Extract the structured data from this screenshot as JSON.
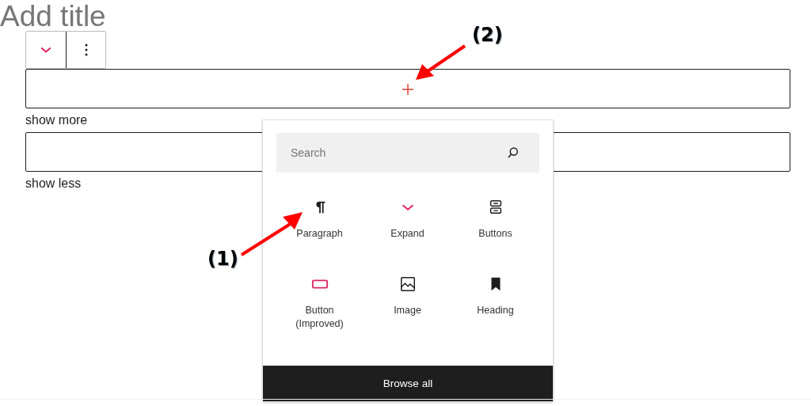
{
  "title_placeholder": "Add title",
  "block_toolbar": {
    "buttons": [
      {
        "kind": "chevron"
      },
      {
        "kind": "more"
      }
    ]
  },
  "blocks": [
    {
      "caption": "show more",
      "has_inserter": true
    },
    {
      "caption": "show less"
    }
  ],
  "inserter": {
    "search": {
      "placeholder": "Search"
    },
    "items": [
      {
        "label": "Paragraph",
        "kind": "paragraph"
      },
      {
        "label": "Expand",
        "kind": "chevron"
      },
      {
        "label": "Buttons",
        "kind": "buttons"
      },
      {
        "label": "Button (Improved)",
        "kind": "button"
      },
      {
        "label": "Image",
        "kind": "image"
      },
      {
        "label": "Heading",
        "kind": "bookmark"
      }
    ],
    "browse_all": "Browse all"
  },
  "callouts": [
    {
      "label": "(1)"
    },
    {
      "label": "(2)"
    }
  ]
}
